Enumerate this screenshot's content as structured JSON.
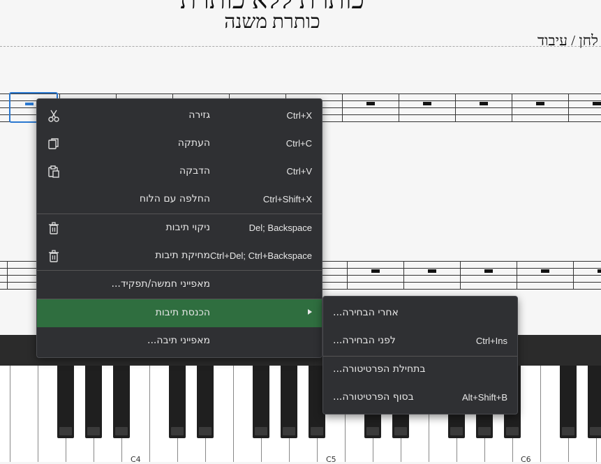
{
  "score": {
    "title": "כותרת ללא כותרת",
    "subtitle": "כותרת משנה",
    "composer": "לחן / עיבוד"
  },
  "piano": {
    "labels": [
      "C4",
      "C5",
      "C6"
    ]
  },
  "context_menu": {
    "items": [
      {
        "label": "גזירה",
        "shortcut": "Ctrl+X",
        "icon": "scissors-icon"
      },
      {
        "label": "העתקה",
        "shortcut": "Ctrl+C",
        "icon": "copy-icon"
      },
      {
        "label": "הדבקה",
        "shortcut": "Ctrl+V",
        "icon": "paste-icon"
      },
      {
        "label": "החלפה עם הלוח",
        "shortcut": "Ctrl+Shift+X",
        "icon": ""
      },
      {
        "label": "ניקוי תיבות",
        "shortcut": "Del; Backspace",
        "icon": "trash-icon"
      },
      {
        "label": "מחיקת תיבות",
        "shortcut": "Ctrl+Del; Ctrl+Backspace",
        "icon": "trash-icon"
      },
      {
        "label": "מאפייני חמשה/תפקיד...",
        "shortcut": "",
        "icon": ""
      },
      {
        "label": "הכנסת תיבות",
        "shortcut": "",
        "icon": "",
        "submenu": true
      },
      {
        "label": "מאפייני תיבה...",
        "shortcut": "",
        "icon": ""
      }
    ]
  },
  "submenu": {
    "items": [
      {
        "label": "אחרי הבחירה...",
        "shortcut": ""
      },
      {
        "label": "לפני הבחירה...",
        "shortcut": "Ctrl+Ins"
      },
      {
        "label": "בתחילת הפרטיטורה...",
        "shortcut": ""
      },
      {
        "label": "בסוף הפרטיטורה...",
        "shortcut": "Alt+Shift+B"
      }
    ]
  },
  "colors": {
    "menu_bg": "#2f3033",
    "highlight": "#2f6e3f",
    "selection": "#2a78d0"
  }
}
